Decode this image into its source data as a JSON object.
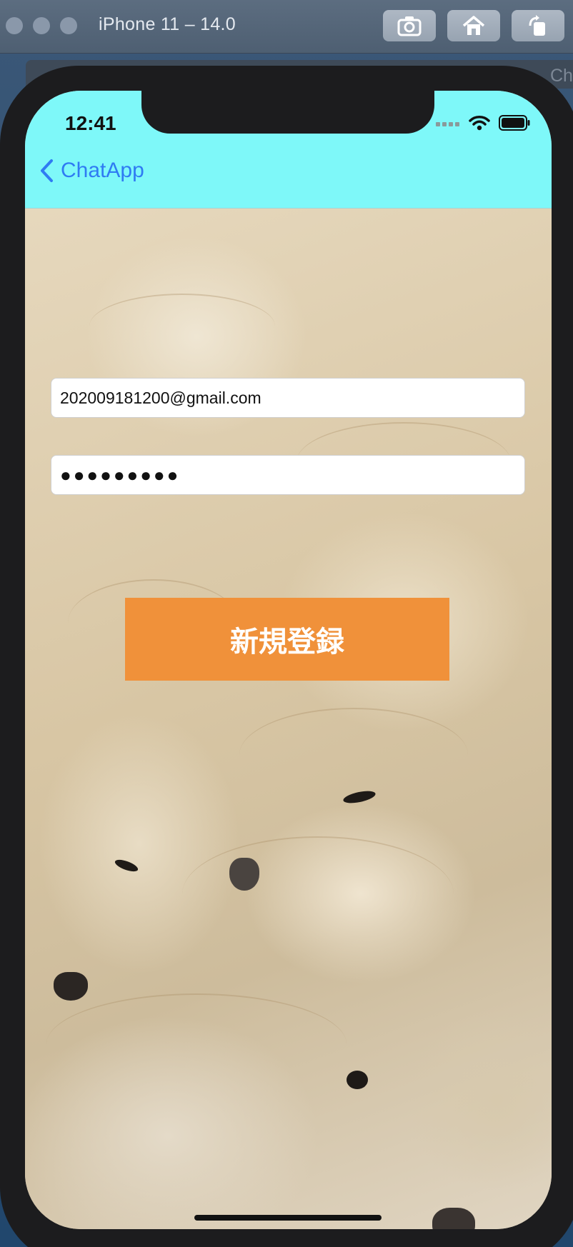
{
  "simulator": {
    "title": "iPhone 11 – 14.0",
    "background_window_label": "Ch",
    "toolbar_icons": [
      "screenshot-icon",
      "home-icon",
      "rotate-icon"
    ]
  },
  "status_bar": {
    "time": "12:41",
    "icons": [
      "cellular-signal-icon",
      "wifi-icon",
      "battery-icon"
    ]
  },
  "nav_bar": {
    "back_label": "ChatApp",
    "background_color": "#7ef8f9",
    "tint_color": "#2f7bf3"
  },
  "form": {
    "email_value": "202009181200@gmail.com",
    "password_value": "●●●●●●●●●",
    "register_label": "新規登録",
    "button_color": "#f0913a"
  }
}
